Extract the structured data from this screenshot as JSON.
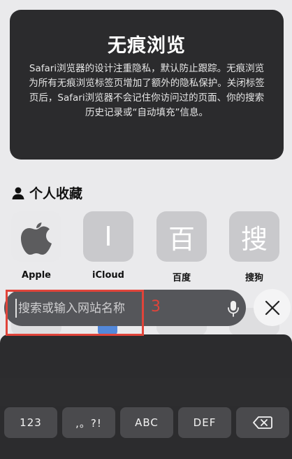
{
  "private_card": {
    "title": "无痕浏览",
    "description": "Safari浏览器的设计注重隐私，默认防止跟踪。无痕浏览为所有无痕浏览标签页增加了额外的隐私保护。关闭标签页后，Safari浏览器不会记住你访问过的页面、你的搜索历史记录或“自动填充”信息。"
  },
  "favorites": {
    "title": "个人收藏",
    "items": [
      {
        "label": "Apple",
        "glyph": ""
      },
      {
        "label": "iCloud",
        "glyph": "I"
      },
      {
        "label": "百度",
        "glyph": "百"
      },
      {
        "label": "搜狗",
        "glyph": "搜"
      }
    ]
  },
  "search": {
    "placeholder": "搜索或输入网站名称",
    "value": ""
  },
  "annotation": {
    "number": "3",
    "color": "#e0443a"
  },
  "keyboard": {
    "keys": [
      "123",
      ",。?!",
      "ABC",
      "DEF"
    ]
  },
  "icons": {
    "person": "person-icon",
    "apple": "apple-logo-icon",
    "mic": "microphone-icon",
    "close": "close-icon",
    "delete": "backspace-icon"
  }
}
